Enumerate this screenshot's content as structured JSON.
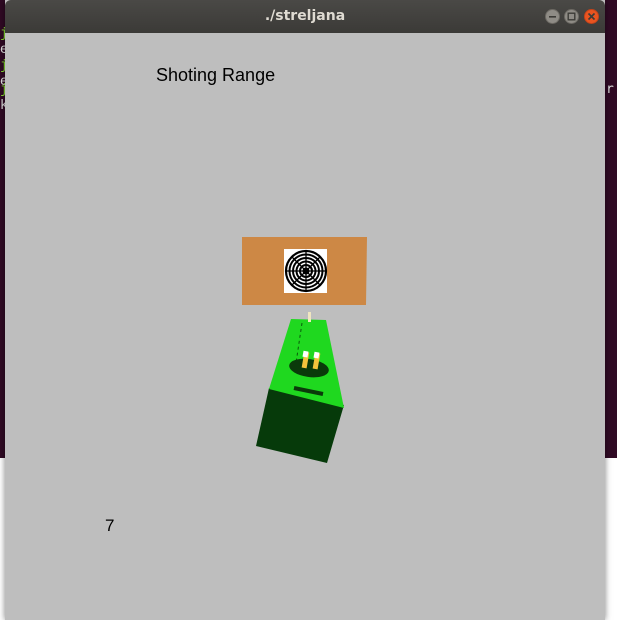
{
  "window": {
    "title": "./streljana"
  },
  "scene": {
    "heading": "Shoting Range",
    "score": "7"
  },
  "colors": {
    "background": "#bebebe",
    "target_board": "#cd8845",
    "gun_light": "#22dd22",
    "gun_dark": "#063a0a",
    "titlebar": "#3c3b37",
    "close_button": "#e95420"
  },
  "icons": {
    "minimize": "minimize-icon",
    "maximize": "maximize-icon",
    "close": "close-icon",
    "target": "bullseye-icon"
  }
}
